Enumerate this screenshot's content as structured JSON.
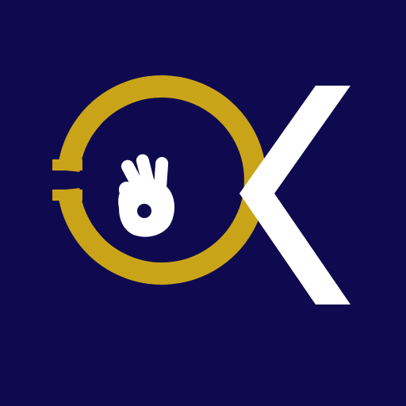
{
  "logo": {
    "name": "ok-hand-logo",
    "icons": {
      "ring": "gold-ring-icon",
      "hand": "ok-hand-gesture-icon",
      "letter": "letter-k-icon"
    },
    "colors": {
      "background": "#0F0A4F",
      "ring": "#C9A418",
      "hand": "#FFFFFF",
      "letter": "#FFFFFF"
    }
  }
}
